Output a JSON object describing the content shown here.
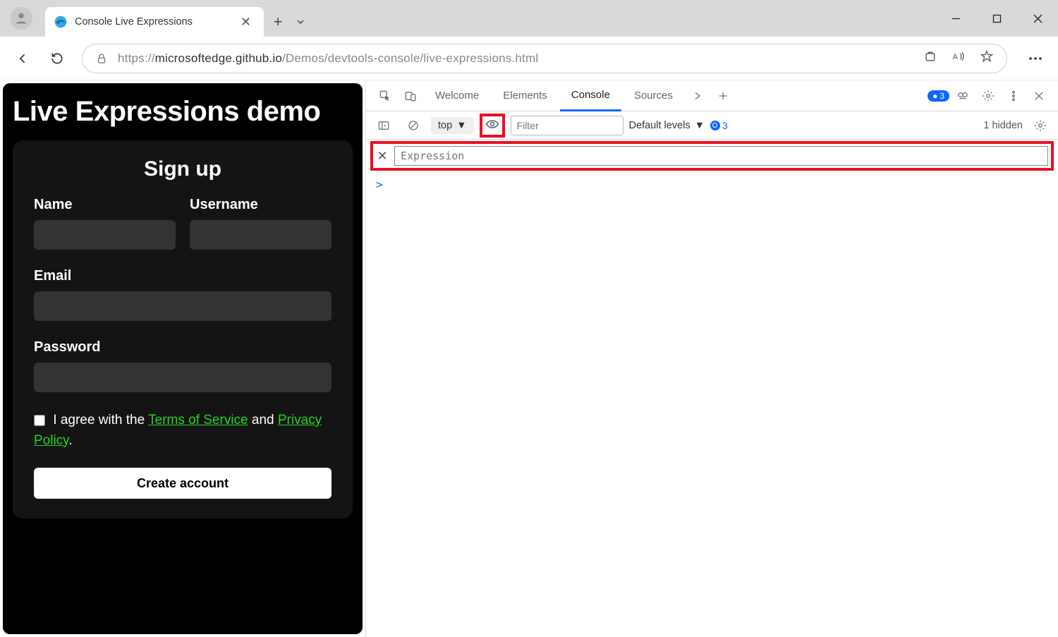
{
  "browser": {
    "tab_title": "Console Live Expressions",
    "url_prefix": "https://",
    "url_host": "microsoftedge.github.io",
    "url_path": "/Demos/devtools-console/live-expressions.html"
  },
  "page": {
    "heading": "Live Expressions demo",
    "card_title": "Sign up",
    "labels": {
      "name": "Name",
      "username": "Username",
      "email": "Email",
      "password": "Password"
    },
    "agree_pre": " I agree with the ",
    "tos": "Terms of Service",
    "agree_mid": " and ",
    "privacy": "Privacy Policy",
    "agree_post": ".",
    "create_btn": "Create account"
  },
  "devtools": {
    "tabs": {
      "welcome": "Welcome",
      "elements": "Elements",
      "console": "Console",
      "sources": "Sources"
    },
    "errors_count": "3",
    "console": {
      "context": "top",
      "filter_placeholder": "Filter",
      "levels": "Default levels",
      "info_count": "3",
      "hidden": "1 hidden",
      "expression_placeholder": "Expression",
      "prompt": ">"
    }
  }
}
